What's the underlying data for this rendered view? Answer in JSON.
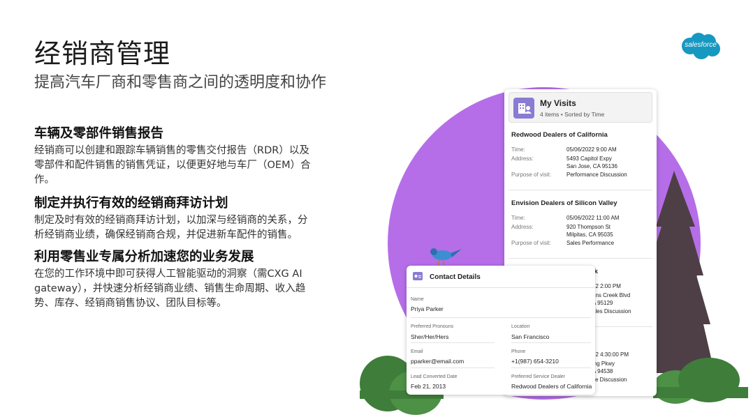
{
  "slide": {
    "title": "经销商管理",
    "subtitle": "提高汽车厂商和零售商之间的透明度和协作",
    "logo_text": "salesforce"
  },
  "sections": [
    {
      "heading": "车辆及零部件销售报告",
      "lines": [
        "经销商可以创建和跟踪车辆销售的零售交付报告（RDR）以及",
        "零部件和配件销售的销售凭证，以便更好地与车厂（OEM）合",
        "作。"
      ]
    },
    {
      "heading": "制定并执行有效的经销商拜访计划",
      "lines": [
        "制定及时有效的经销商拜访计划，以加深与经销商的关系，分",
        "析经销商业绩，确保经销商合规，并促进新车配件的销售。"
      ]
    },
    {
      "heading": "利用零售业专属分析加速您的业务发展",
      "lines": [
        "在您的工作环境中即可获得人工智能驱动的洞察（需CXG AI",
        "gateway），并快速分析经销商业绩、销售生命周期、收入趋",
        "势、库存、经销商销售协议、团队目标等。"
      ]
    }
  ],
  "my_visits": {
    "title": "My Visits",
    "subtitle": "4 items • Sorted by Time",
    "labels": {
      "time": "Time:",
      "address": "Address:",
      "purpose": "Purpose of visit:"
    },
    "visits": [
      {
        "name": "Redwood Dealers of California",
        "time": "05/06/2022 9:00 AM",
        "address_line1": "5493 Capitol Expy",
        "address_line2": "San Jose, CA 95136",
        "purpose": "Performance Discussion"
      },
      {
        "name": "Envision Dealers of Silicon Valley",
        "time": "05/06/2022 11:00 AM",
        "address_line1": "920 Thompson St",
        "address_line2": "Milpitas, CA 95035",
        "purpose": "Sales Performance"
      },
      {
        "name": "eek",
        "time": "22 2:00 PM",
        "address_line1": "ens Creek Blvd",
        "address_line2": "A 95129",
        "purpose": "ales Discussion"
      },
      {
        "name": "",
        "time": "22 4:30:00 PM",
        "address_line1": "ing Pkwy",
        "address_line2": "A 94538",
        "purpose": "ce Discussion"
      }
    ]
  },
  "contact_details": {
    "title": "Contact Details",
    "name_label": "Name",
    "name": "Priya Parker",
    "pronouns_label": "Preferred Pronouns",
    "pronouns": "Sher/Her/Hers",
    "location_label": "Location",
    "location": "San Francisco",
    "email_label": "Email",
    "email": "pparker@email.com",
    "phone_label": "Phone",
    "phone": "+1(987) 654-3210",
    "lead_label": "Lead Converted Date",
    "lead_date": "Feb 21, 2013",
    "dealer_label": "Preferred Service Dealer",
    "dealer": "Redwood Dealers of California"
  },
  "colors": {
    "purple_circle": "#b66ee8",
    "salesforce_blue": "#1798c1",
    "tree_dark": "#4e3f47",
    "tree_trunk": "#6b3f2a",
    "bush_green": "#3f7d3a",
    "icon_purple": "#8a7bd4"
  }
}
